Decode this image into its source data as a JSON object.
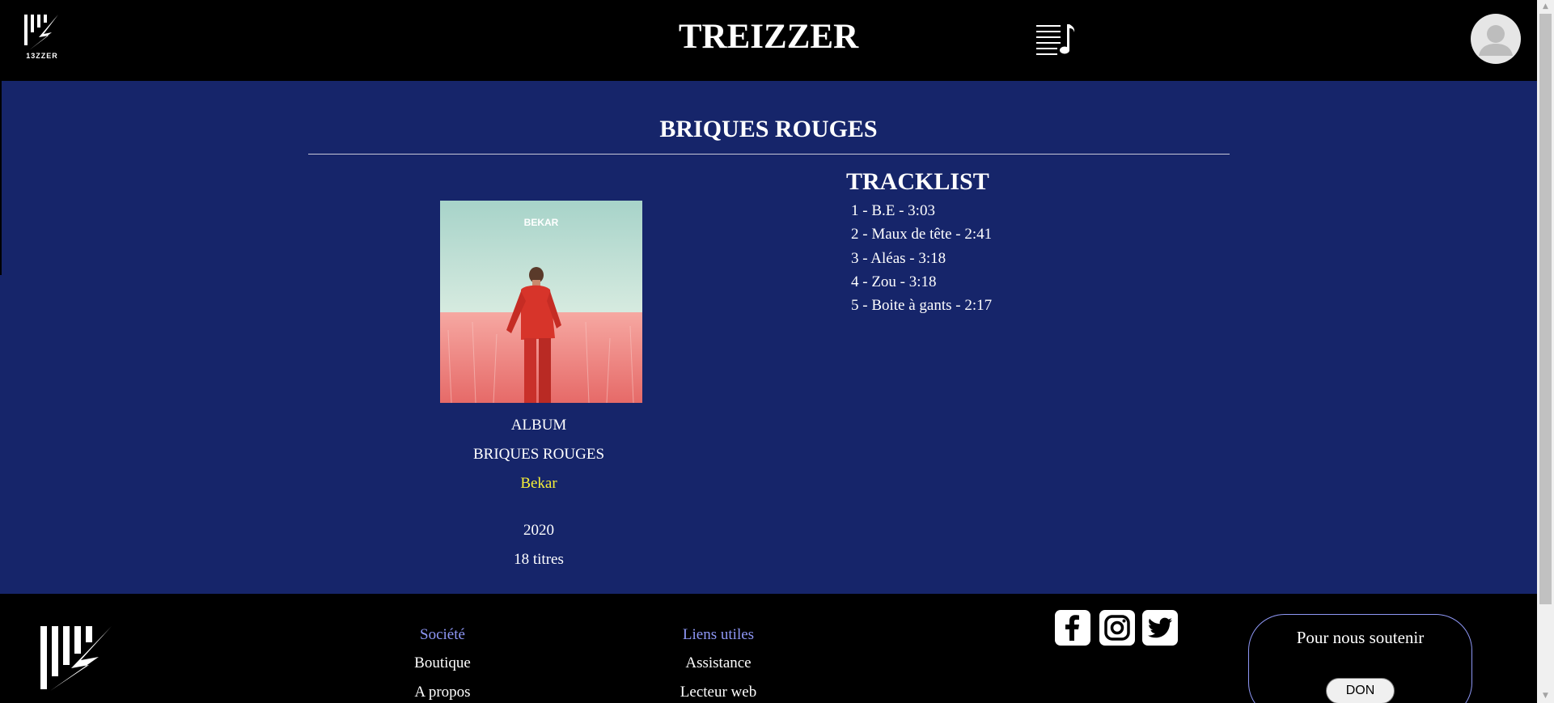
{
  "header": {
    "logo_text": "13ZZER",
    "brand": "TREIZZER",
    "playlist_icon": "playlist-music-icon",
    "avatar_icon": "user-avatar-icon"
  },
  "album": {
    "heading": "BRIQUES ROUGES",
    "cover_text": "BEKAR",
    "type": "ALBUM",
    "title": "BRIQUES ROUGES",
    "artist": "Bekar",
    "year": "2020",
    "track_count": "18 titres"
  },
  "tracklist": {
    "title": "TRACKLIST",
    "tracks": [
      "1 - B.E - 3:03",
      "2 - Maux de tête - 2:41",
      "3 - Aléas - 3:18",
      "4 - Zou - 3:18",
      "5 - Boite à gants - 2:17"
    ]
  },
  "footer": {
    "societe": {
      "heading": "Société",
      "links": [
        "Boutique",
        "A propos"
      ]
    },
    "liens": {
      "heading": "Liens utiles",
      "links": [
        "Assistance",
        "Lecteur web"
      ]
    },
    "social_icons": [
      "facebook-icon",
      "instagram-icon",
      "twitter-icon"
    ],
    "support": {
      "title": "Pour nous soutenir",
      "button": "DON"
    }
  },
  "colors": {
    "main_background": "#16256a",
    "header_background": "#000000",
    "artist_link": "#f6ef38",
    "footer_heading": "#8e97f5"
  }
}
